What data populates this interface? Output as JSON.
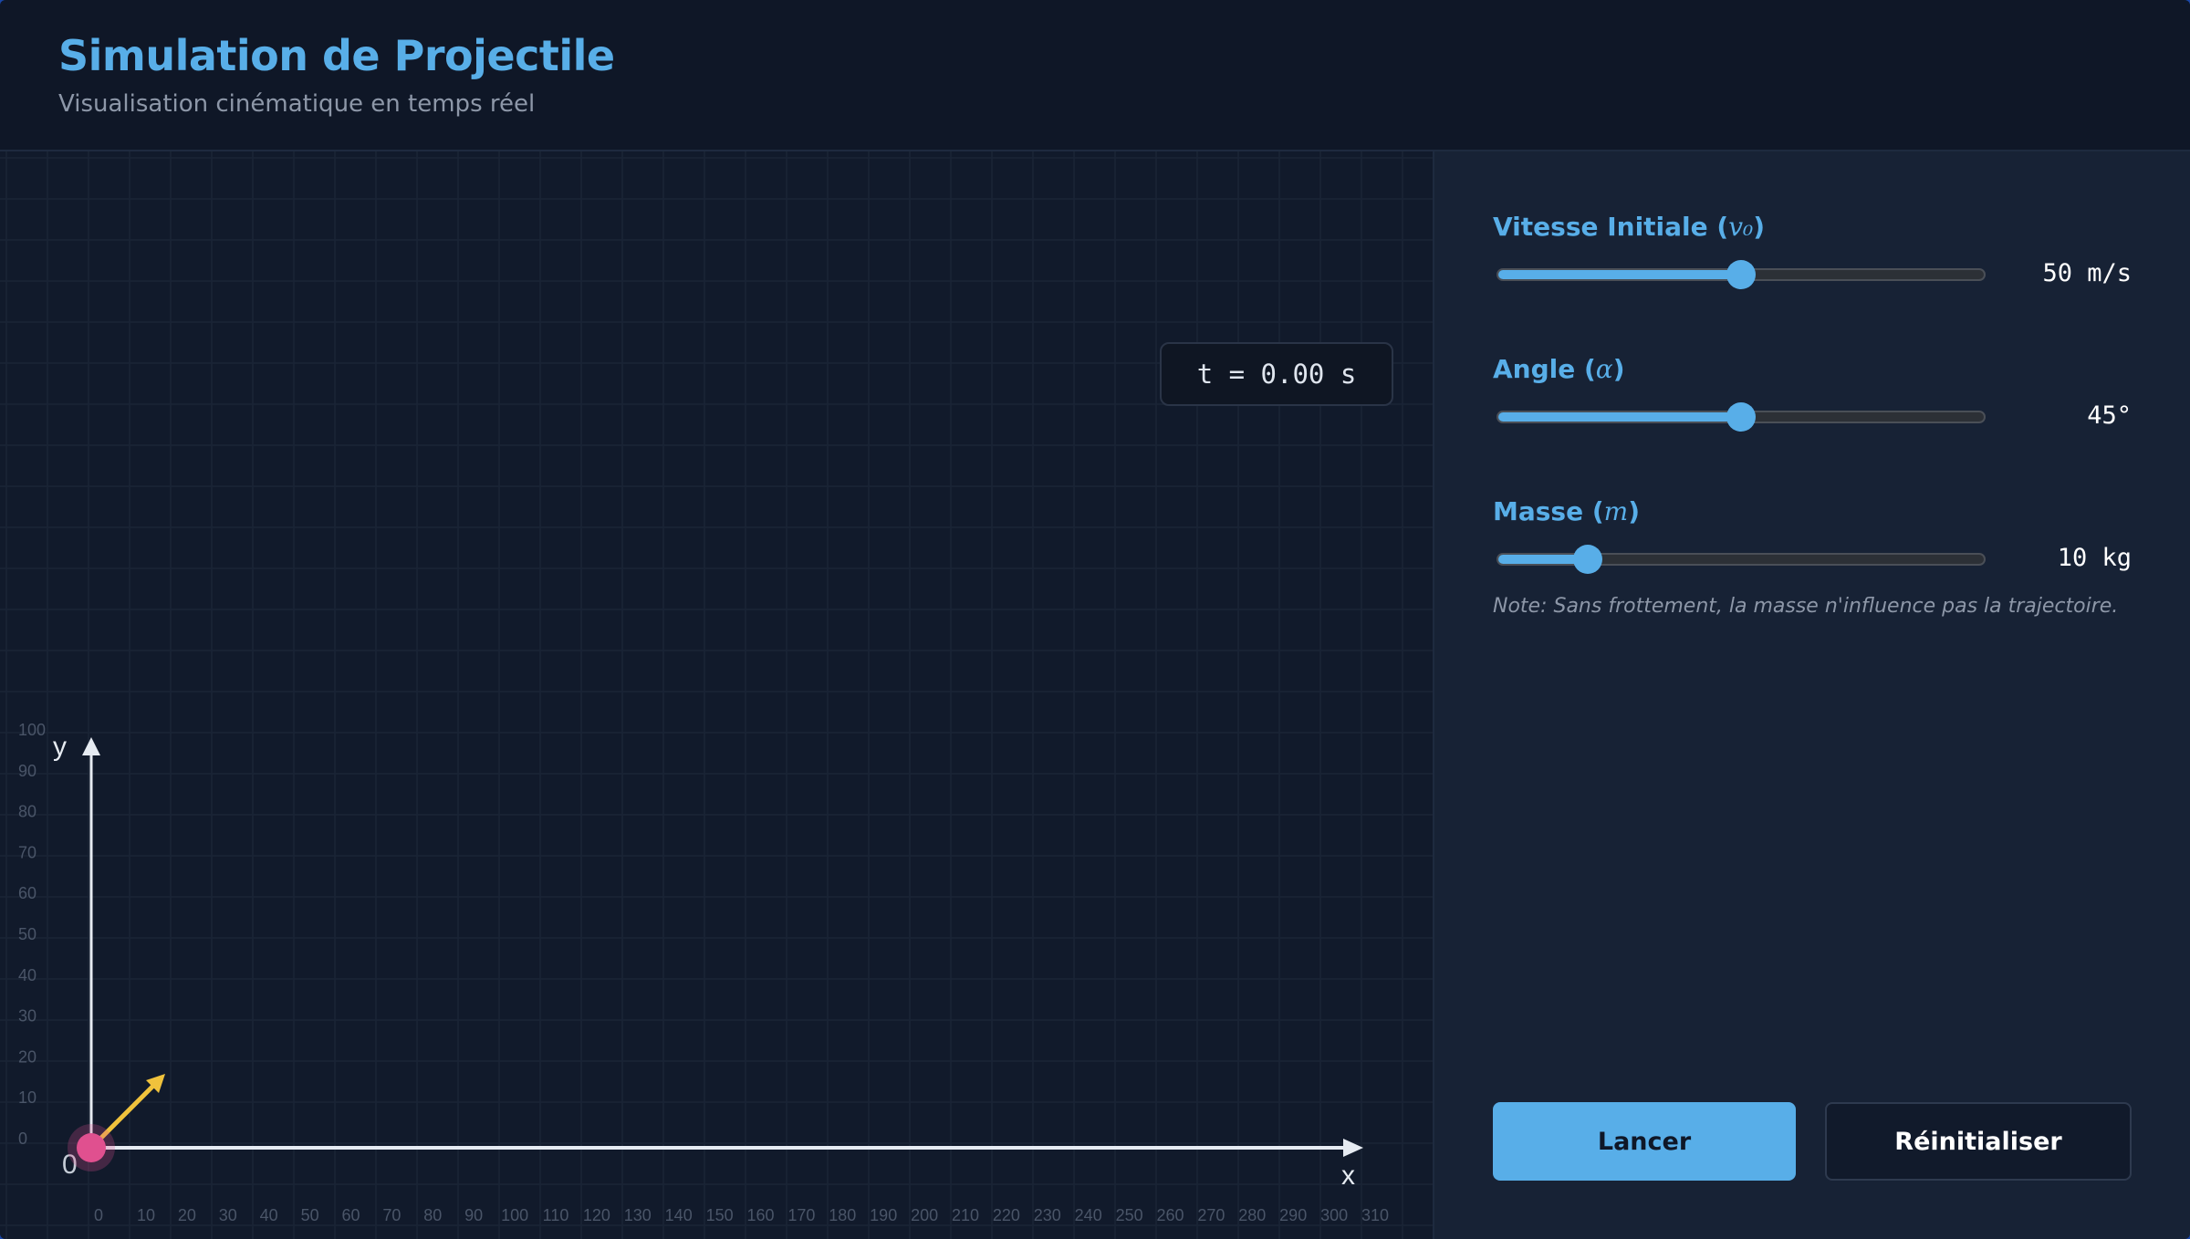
{
  "header": {
    "title": "Simulation de Projectile",
    "subtitle": "Visualisation cinématique en temps réel"
  },
  "simulation": {
    "time_label": "t = 0.00 s",
    "x_axis_label": "x",
    "y_axis_label": "y",
    "origin_label": "0",
    "x_ticks": [
      "0",
      "10",
      "20",
      "30",
      "40",
      "50",
      "60",
      "70",
      "80",
      "90",
      "100",
      "110",
      "120",
      "130",
      "140",
      "150",
      "160",
      "170",
      "180",
      "190",
      "200",
      "210",
      "220",
      "230",
      "240",
      "250",
      "260",
      "270",
      "280",
      "290",
      "300",
      "310"
    ],
    "y_ticks": [
      "100",
      "90",
      "80",
      "70",
      "60",
      "50",
      "40",
      "30",
      "20",
      "10",
      "0"
    ],
    "projectile_color": "#e0508f",
    "velocity_vector_color": "#f0c23c"
  },
  "controls": {
    "velocity": {
      "label": "Vitesse Initiale (",
      "symbol": "v₀",
      "label_end": ")",
      "value": 50,
      "min": 0,
      "max": 100,
      "display": "50 m/s"
    },
    "angle": {
      "label": "Angle (",
      "symbol": "α",
      "label_end": ")",
      "value": 45,
      "min": 0,
      "max": 90,
      "display": "45°"
    },
    "mass": {
      "label": "Masse (",
      "symbol": "m",
      "label_end": ")",
      "value": 10,
      "min": 1,
      "max": 50,
      "display": "10 kg"
    },
    "note": "Note: Sans frottement, la masse n'influence pas la trajectoire."
  },
  "buttons": {
    "launch": "Lancer",
    "reset": "Réinitialiser"
  },
  "colors": {
    "accent": "#58aee8",
    "background": "#111a2b",
    "panel": "#172235"
  }
}
